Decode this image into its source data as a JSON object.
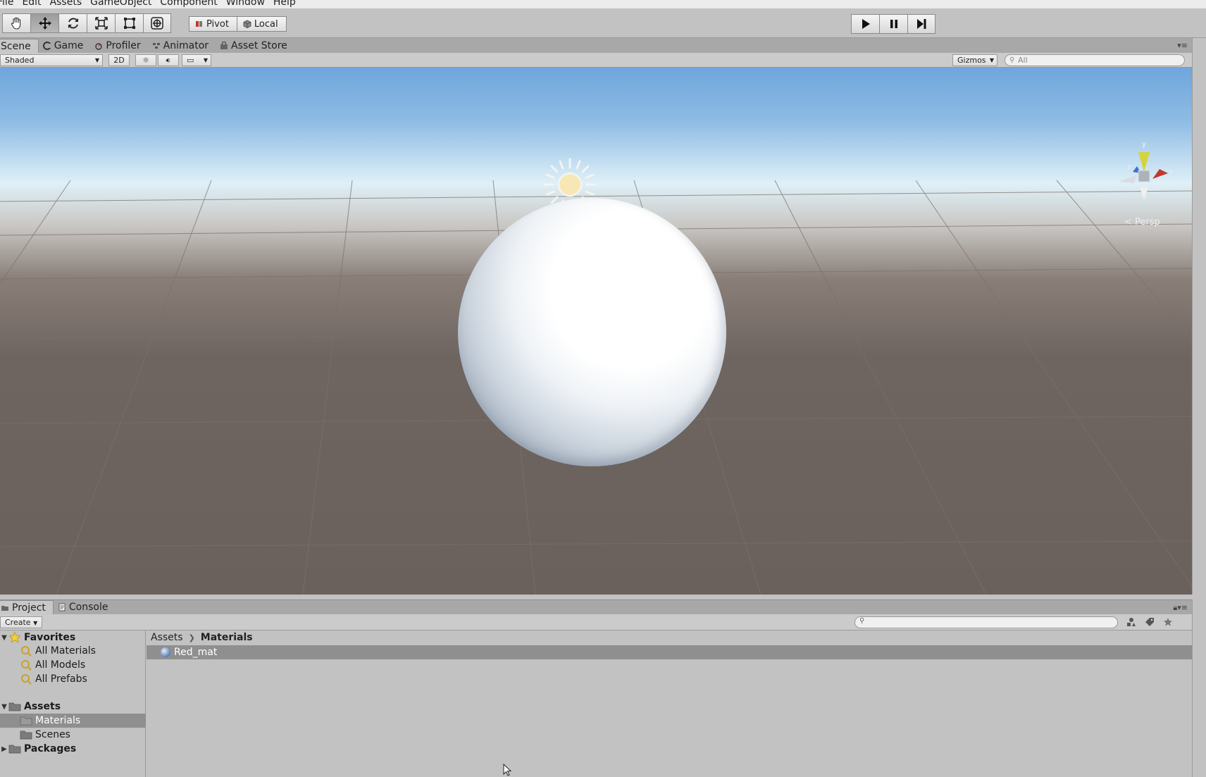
{
  "menu": [
    "File",
    "Edit",
    "Assets",
    "GameObject",
    "Component",
    "Window",
    "Help"
  ],
  "toolbar": {
    "pivot_label": "Pivot",
    "local_label": "Local"
  },
  "scene_tabs": [
    {
      "label": "Scene",
      "icon": "scene-icon",
      "active": true
    },
    {
      "label": "Game",
      "icon": "game-icon"
    },
    {
      "label": "Profiler",
      "icon": "profiler-icon"
    },
    {
      "label": "Animator",
      "icon": "animator-icon"
    },
    {
      "label": "Asset Store",
      "icon": "asset-store-icon"
    }
  ],
  "scene_bar": {
    "shading_mode": "Shaded",
    "mode_2d": "2D",
    "gizmos_label": "Gizmos",
    "search_placeholder": "All"
  },
  "viewport": {
    "gizmo_axis_y": "y",
    "gizmo_axis_x": "x",
    "gizmo_axis_z": "z",
    "projection_label": "Persp"
  },
  "bottom_tabs": [
    {
      "label": "Project",
      "icon": "project-icon",
      "active": true
    },
    {
      "label": "Console",
      "icon": "console-icon"
    }
  ],
  "project": {
    "create_label": "Create",
    "tree": {
      "favorites_label": "Favorites",
      "favorites": [
        "All Materials",
        "All Models",
        "All Prefabs"
      ],
      "assets_label": "Assets",
      "asset_folders": [
        "Materials",
        "Scenes"
      ],
      "selected_folder": "Materials",
      "packages_label": "Packages"
    },
    "breadcrumb": [
      "Assets",
      "Materials"
    ],
    "files": [
      {
        "name": "Red_mat",
        "icon": "material-icon"
      }
    ]
  },
  "colors": {
    "selection": "#8f8f8f",
    "panel_bg": "#c2c2c2",
    "ground": "#6a615c"
  }
}
